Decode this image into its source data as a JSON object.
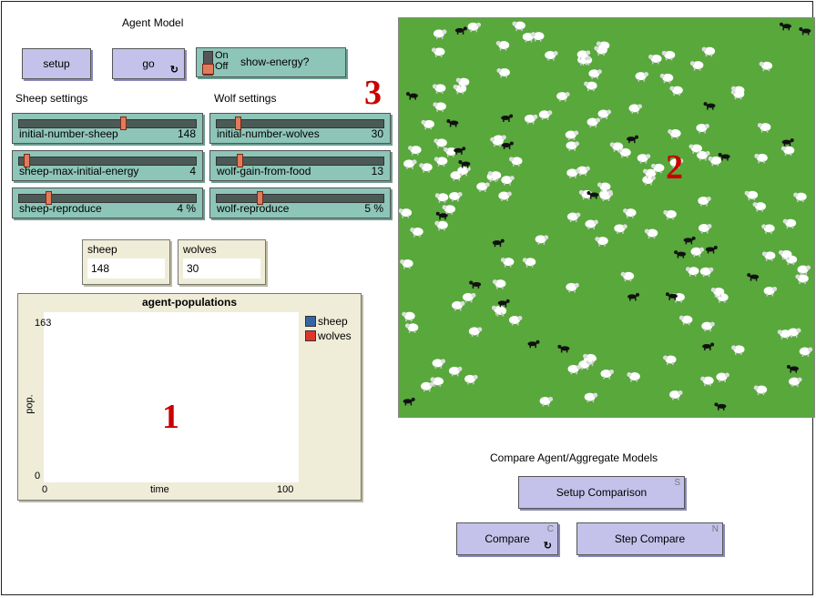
{
  "header": {
    "title": "Agent Model"
  },
  "buttons": {
    "setup": "setup",
    "go": "go",
    "go_forever_icon": "↻",
    "setup_comparison": "Setup Comparison",
    "setup_comparison_hotkey": "S",
    "compare": "Compare",
    "compare_hotkey": "C",
    "compare_forever_icon": "↻",
    "step_compare": "Step Compare",
    "step_compare_hotkey": "N"
  },
  "switch": {
    "on": "On",
    "off": "Off",
    "label": "show-energy?"
  },
  "sections": {
    "sheep": "Sheep settings",
    "wolf": "Wolf settings"
  },
  "sliders": {
    "initial_number_sheep": {
      "label": "initial-number-sheep",
      "value": "148",
      "fraction": 0.59
    },
    "sheep_max_initial_energy": {
      "label": "sheep-max-initial-energy",
      "value": "4",
      "fraction": 0.03
    },
    "sheep_reproduce": {
      "label": "sheep-reproduce",
      "value": "4 %",
      "fraction": 0.16
    },
    "initial_number_wolves": {
      "label": "initial-number-wolves",
      "value": "30",
      "fraction": 0.12
    },
    "wolf_gain_from_food": {
      "label": "wolf-gain-from-food",
      "value": "13",
      "fraction": 0.13
    },
    "wolf_reproduce": {
      "label": "wolf-reproduce",
      "value": "5 %",
      "fraction": 0.25
    }
  },
  "monitors": {
    "sheep": {
      "label": "sheep",
      "value": "148"
    },
    "wolves": {
      "label": "wolves",
      "value": "30"
    }
  },
  "plot": {
    "title": "agent-populations",
    "ylabel": "pop.",
    "xlabel": "time",
    "y_max": "163",
    "y_min": "0",
    "x_min": "0",
    "x_max": "100",
    "legend": [
      {
        "name": "sheep",
        "color": "#3465a4"
      },
      {
        "name": "wolves",
        "color": "#e0352b"
      }
    ]
  },
  "compare_section": {
    "title": "Compare Agent/Aggregate Models"
  },
  "annotations": {
    "one": "1",
    "two": "2",
    "three": "3"
  },
  "colors": {
    "world_green": "#58a83c",
    "button": "#c4c2ea",
    "widget": "#8dc5b8",
    "monitor": "#efecd8",
    "annotation": "#c80000"
  }
}
